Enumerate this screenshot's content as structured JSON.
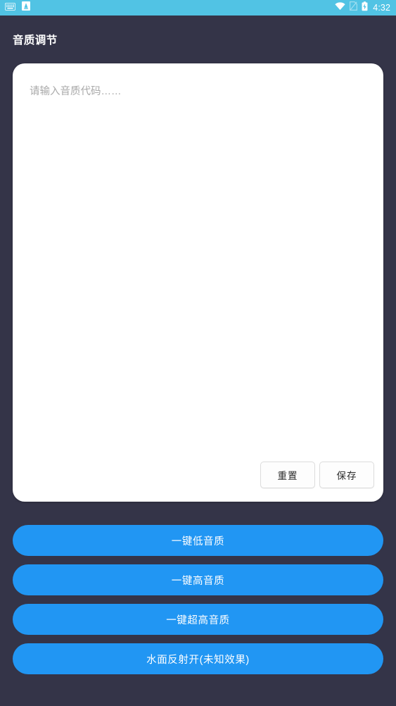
{
  "status_bar": {
    "background_color": "#51C3E4",
    "left_icons": [
      {
        "name": "keyboard-icon",
        "label": "keyboard"
      },
      {
        "name": "app-notification-icon",
        "label": "A"
      }
    ],
    "right_icons": [
      {
        "name": "wifi-icon",
        "label": "wifi"
      },
      {
        "name": "sim-card-icon",
        "label": "no sim"
      },
      {
        "name": "battery-charging-icon",
        "label": "battery"
      }
    ],
    "time": "4:32"
  },
  "header": {
    "title": "音质调节",
    "background_color": "#343448"
  },
  "editor": {
    "placeholder": "请输入音质代码……",
    "value": "",
    "reset_label": "重置",
    "save_label": "保存"
  },
  "actions": {
    "accent_color": "#2196F3",
    "buttons": [
      {
        "label": "一键低音质"
      },
      {
        "label": "一键高音质"
      },
      {
        "label": "一键超高音质"
      },
      {
        "label": "水面反射开(未知效果)"
      }
    ]
  }
}
